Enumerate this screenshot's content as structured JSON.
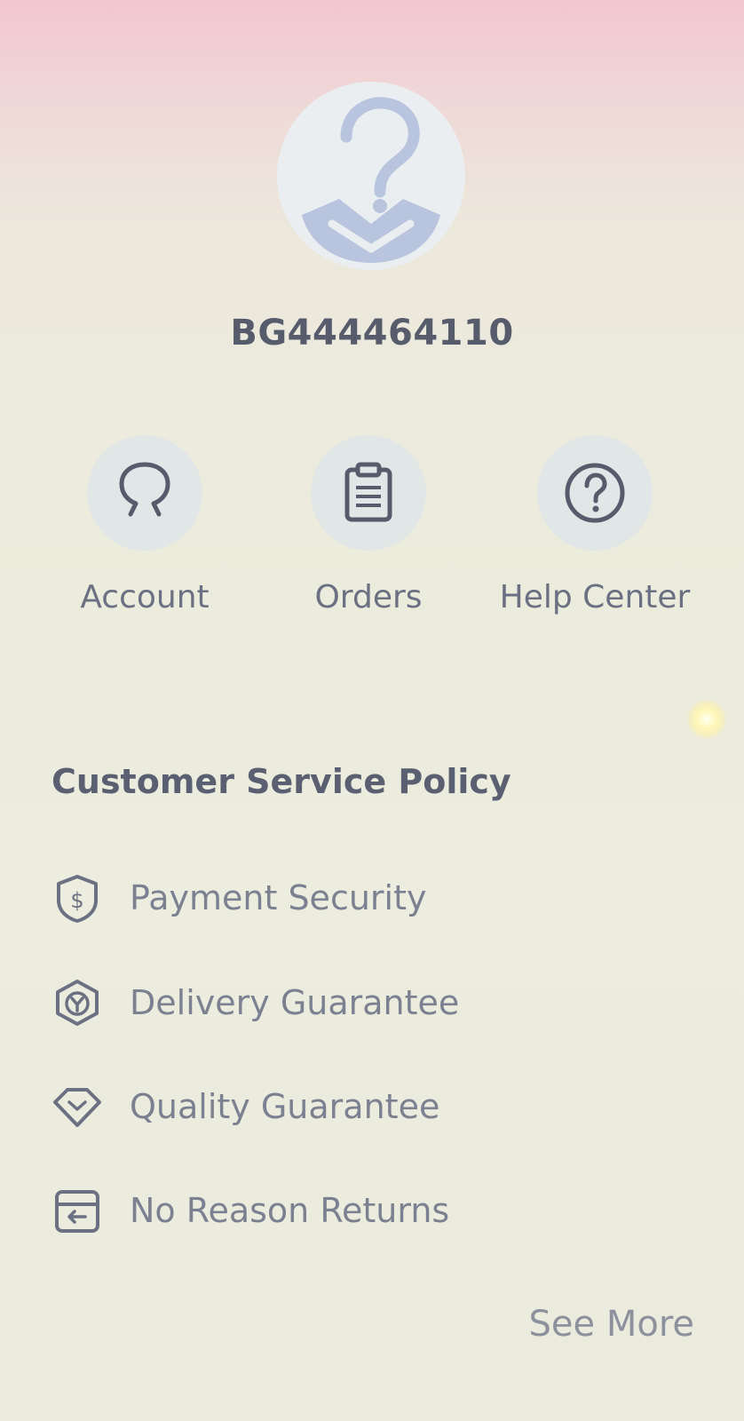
{
  "profile": {
    "user_id": "BG444464110",
    "avatar_icon": "question-mark-avatar-icon"
  },
  "quick_links": [
    {
      "label": "Account",
      "icon": "account-icon"
    },
    {
      "label": "Orders",
      "icon": "clipboard-icon"
    },
    {
      "label": "Help Center",
      "icon": "question-circle-icon"
    }
  ],
  "policy": {
    "title": "Customer Service Policy",
    "items": [
      {
        "label": "Payment Security",
        "icon": "shield-dollar-icon"
      },
      {
        "label": "Delivery Guarantee",
        "icon": "box-check-icon"
      },
      {
        "label": "Quality Guarantee",
        "icon": "diamond-check-icon"
      },
      {
        "label": "No Reason Returns",
        "icon": "return-box-icon"
      }
    ],
    "see_more_label": "See More"
  },
  "colors": {
    "accent_icon": "#b9c4df",
    "text_dark": "#565c6c",
    "text_muted": "#7c8192"
  }
}
